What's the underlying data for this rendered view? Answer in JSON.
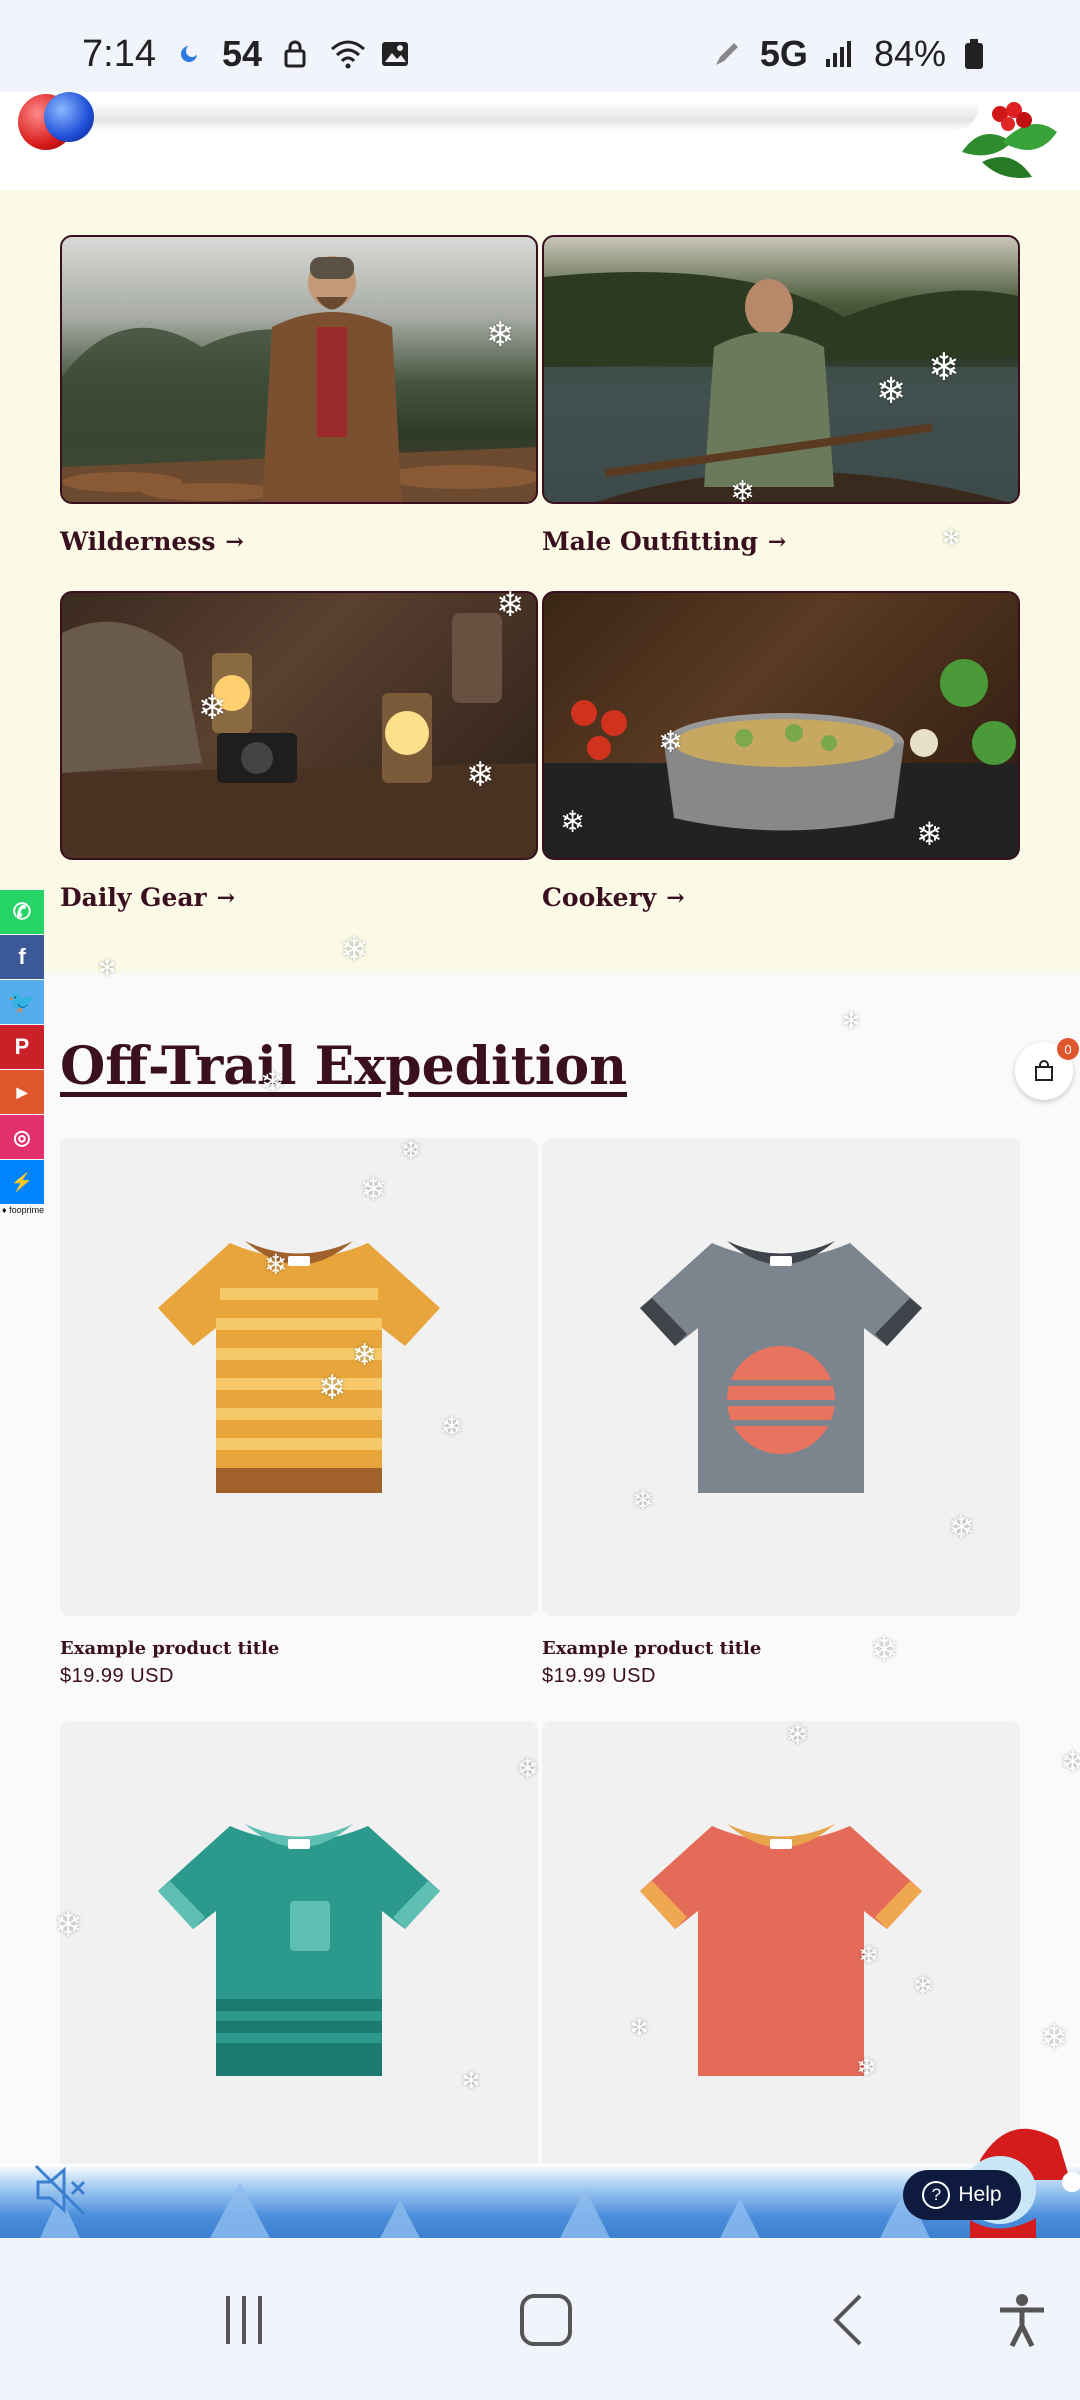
{
  "status_bar": {
    "time": "7:14",
    "notif_number": "54",
    "network": "5G",
    "battery": "84%",
    "icons": [
      "weather-icon",
      "lock-icon",
      "wifi-icon",
      "image-icon",
      "pen-icon",
      "signal-icon",
      "battery-icon"
    ]
  },
  "categories": [
    {
      "label": "Wilderness",
      "image": "man-in-forest-photo"
    },
    {
      "label": "Male Outfitting",
      "image": "man-in-canoe-photo"
    },
    {
      "label": "Daily Gear",
      "image": "lanterns-and-camera-photo"
    },
    {
      "label": "Cookery",
      "image": "cooking-pot-photo"
    }
  ],
  "social": {
    "items": [
      "whatsapp",
      "facebook",
      "twitter",
      "pinterest",
      "youtube",
      "instagram",
      "messenger"
    ],
    "colors": [
      "#25d366",
      "#3b5998",
      "#55acee",
      "#cb2027",
      "#e0572e",
      "#e1306c",
      "#0084ff"
    ],
    "caption": "♦ fooprime"
  },
  "collection": {
    "title": "Off-Trail Expedition",
    "cart_count": "0",
    "products": [
      {
        "title": "Example product title",
        "price": "$19.99 USD",
        "shirt_color": "#e7a53b",
        "accent": "#f5c86a",
        "collar": "#a0622a"
      },
      {
        "title": "Example product title",
        "price": "$19.99 USD",
        "shirt_color": "#7c858e",
        "accent": "#e8735f",
        "collar": "#3e4449"
      },
      {
        "title": "",
        "price": "",
        "shirt_color": "#2b9a8d",
        "accent": "#1d7a70",
        "collar": "#5fbfb3"
      },
      {
        "title": "",
        "price": "",
        "shirt_color": "#e46b58",
        "accent": "#f0a850",
        "collar": "#e8a44a"
      }
    ]
  },
  "help_button": {
    "label": "Help"
  },
  "nav_bar": {
    "items": [
      "recents-button",
      "home-button",
      "back-button",
      "accessibility-button"
    ]
  }
}
